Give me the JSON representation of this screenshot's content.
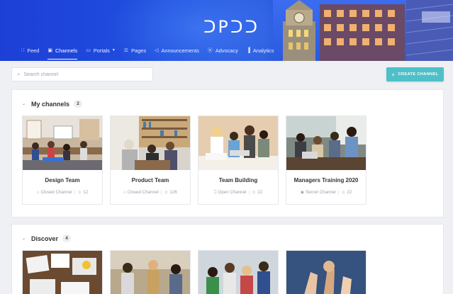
{
  "header": {
    "logo_text": "ᑐPᑐᑐ",
    "brand_color": "#2051e0",
    "nav": [
      {
        "label": "Feed",
        "icon": "rss-icon"
      },
      {
        "label": "Channels",
        "icon": "channels-icon",
        "active": true
      },
      {
        "label": "Portals",
        "icon": "portal-icon",
        "has_dropdown": true
      },
      {
        "label": "Pages",
        "icon": "page-icon"
      },
      {
        "label": "Announcements",
        "icon": "megaphone-icon"
      },
      {
        "label": "Advocacy",
        "icon": "broadcast-icon"
      },
      {
        "label": "Analytics",
        "icon": "chart-icon"
      }
    ]
  },
  "toolbar": {
    "search_placeholder": "Search channel",
    "create_label": "CREATE CHANNEL",
    "accent": "#4ec0c8"
  },
  "my_channels": {
    "title": "My channels",
    "count": "2",
    "cards": [
      {
        "name": "Design Team",
        "type": "Closed Channel",
        "type_icon": "lock-icon",
        "members": "12"
      },
      {
        "name": "Product Team",
        "type": "Closed Channel",
        "type_icon": "lock-icon",
        "members": "126"
      },
      {
        "name": "Team Building",
        "type": "Open Channel",
        "type_icon": "open-door-icon",
        "members": "22"
      },
      {
        "name": "Managers Training 2020",
        "type": "Secret Channel",
        "type_icon": "eye-off-icon",
        "members": "22"
      }
    ]
  },
  "discover": {
    "title": "Discover",
    "count": "4"
  }
}
